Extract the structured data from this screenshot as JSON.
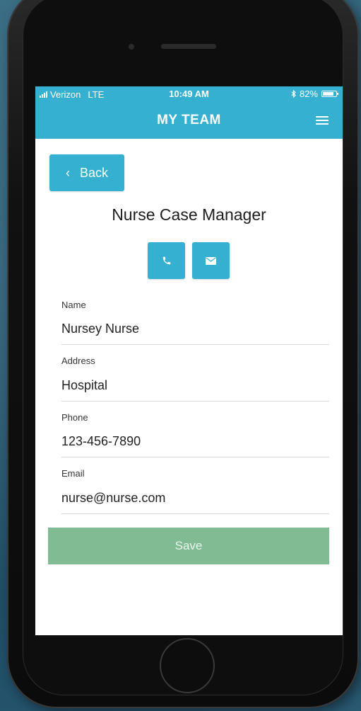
{
  "statusbar": {
    "carrier": "Verizon",
    "network": "LTE",
    "time": "10:49 AM",
    "battery": "82%",
    "battery_level": 0.82
  },
  "navbar": {
    "title": "MY TEAM",
    "menu_icon": "hamburger-menu-icon"
  },
  "back_button": {
    "label": "Back",
    "icon": "chevron-left-icon"
  },
  "page_title": "Nurse Case Manager",
  "actions": {
    "call_icon": "phone-icon",
    "email_icon": "envelope-icon"
  },
  "fields": {
    "name": {
      "label": "Name",
      "value": "Nursey Nurse"
    },
    "address": {
      "label": "Address",
      "value": "Hospital"
    },
    "phone": {
      "label": "Phone",
      "value": "123-456-7890"
    },
    "email": {
      "label": "Email",
      "value": "nurse@nurse.com"
    }
  },
  "save_button": {
    "label": "Save"
  },
  "colors": {
    "accent": "#36b0d1",
    "save": "#80bb94"
  }
}
